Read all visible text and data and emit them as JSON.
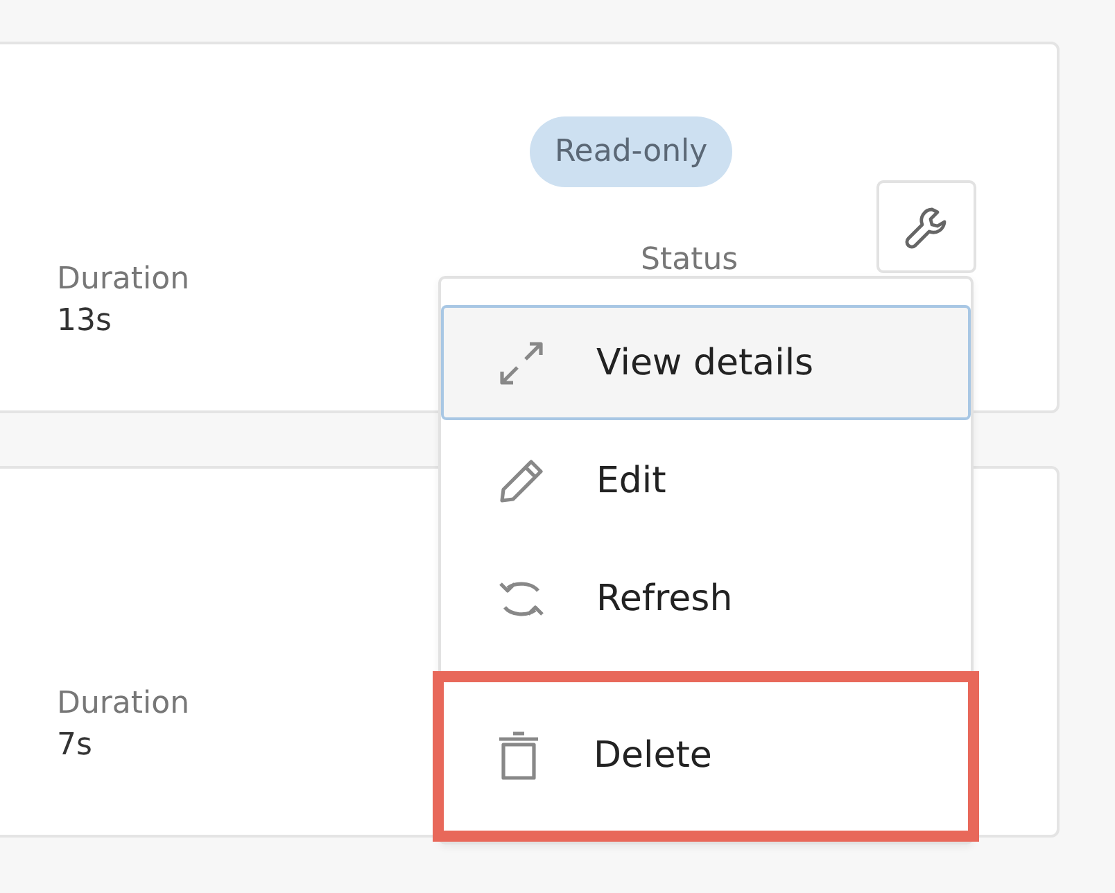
{
  "cards": [
    {
      "badge": "Read-only",
      "fields": [
        {
          "label": "Duration",
          "value": "13s"
        },
        {
          "label": "Status"
        }
      ],
      "has_tool_button": true
    },
    {
      "fields": [
        {
          "label": "Duration",
          "value": "7s"
        }
      ],
      "has_tool_button": false
    }
  ],
  "menu": {
    "items": [
      {
        "kind": "expand",
        "label": "View details",
        "selected": true,
        "highlighted": false
      },
      {
        "kind": "edit",
        "label": "Edit",
        "selected": false,
        "highlighted": false
      },
      {
        "kind": "refresh",
        "label": "Refresh",
        "selected": false,
        "highlighted": false
      },
      {
        "kind": "delete",
        "label": "Delete",
        "selected": false,
        "highlighted": true
      }
    ]
  }
}
